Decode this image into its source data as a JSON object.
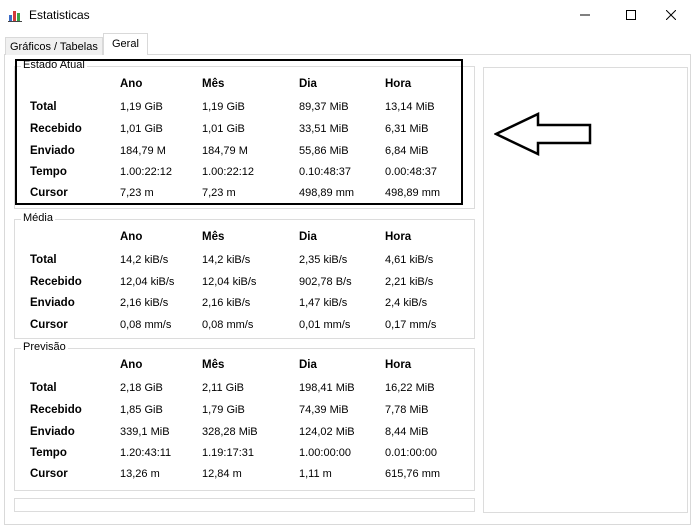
{
  "window": {
    "title": "Estatisticas",
    "icon": "bar-chart-icon",
    "buttons": [
      "minimize-icon",
      "maximize-icon",
      "close-icon"
    ]
  },
  "tabs": [
    {
      "label": "Gráficos / Tabelas",
      "active": false
    },
    {
      "label": "Geral",
      "active": true
    }
  ],
  "columns": [
    "Ano",
    "Mês",
    "Dia",
    "Hora"
  ],
  "groups": {
    "estado": {
      "title": "Estado Atual",
      "rows": [
        {
          "label": "Total",
          "values": [
            "1,19 GiB",
            "1,19 GiB",
            "89,37 MiB",
            "13,14 MiB"
          ]
        },
        {
          "label": "Recebido",
          "values": [
            "1,01 GiB",
            "1,01 GiB",
            "33,51 MiB",
            "6,31 MiB"
          ]
        },
        {
          "label": "Enviado",
          "values": [
            "184,79 M",
            "184,79 M",
            "55,86 MiB",
            "6,84 MiB"
          ]
        },
        {
          "label": "Tempo",
          "values": [
            "1.00:22:12",
            "1.00:22:12",
            "0.10:48:37",
            "0.00:48:37"
          ]
        },
        {
          "label": "Cursor",
          "values": [
            "7,23 m",
            "7,23 m",
            "498,89 mm",
            "498,89 mm"
          ]
        }
      ]
    },
    "media": {
      "title": "Média",
      "rows": [
        {
          "label": "Total",
          "values": [
            "14,2 kiB/s",
            "14,2 kiB/s",
            "2,35 kiB/s",
            "4,61 kiB/s"
          ]
        },
        {
          "label": "Recebido",
          "values": [
            "12,04 kiB/s",
            "12,04 kiB/s",
            "902,78 B/s",
            "2,21 kiB/s"
          ]
        },
        {
          "label": "Enviado",
          "values": [
            "2,16 kiB/s",
            "2,16 kiB/s",
            "1,47 kiB/s",
            "2,4 kiB/s"
          ]
        },
        {
          "label": "Cursor",
          "values": [
            "0,08 mm/s",
            "0,08 mm/s",
            "0,01 mm/s",
            "0,17 mm/s"
          ]
        }
      ]
    },
    "previsao": {
      "title": "Previsão",
      "rows": [
        {
          "label": "Total",
          "values": [
            "2,18 GiB",
            "2,11 GiB",
            "198,41 MiB",
            "16,22 MiB"
          ]
        },
        {
          "label": "Recebido",
          "values": [
            "1,85 GiB",
            "1,79 GiB",
            "74,39 MiB",
            "7,78 MiB"
          ]
        },
        {
          "label": "Enviado",
          "values": [
            "339,1 MiB",
            "328,28 MiB",
            "124,02 MiB",
            "8,44 MiB"
          ]
        },
        {
          "label": "Tempo",
          "values": [
            "1.20:43:11",
            "1.19:17:31",
            "1.00:00:00",
            "0.01:00:00"
          ]
        },
        {
          "label": "Cursor",
          "values": [
            "13,26 m",
            "12,84 m",
            "1,11 m",
            "615,76 mm"
          ]
        }
      ]
    }
  },
  "annotation": {
    "icon": "arrow-left-icon"
  }
}
